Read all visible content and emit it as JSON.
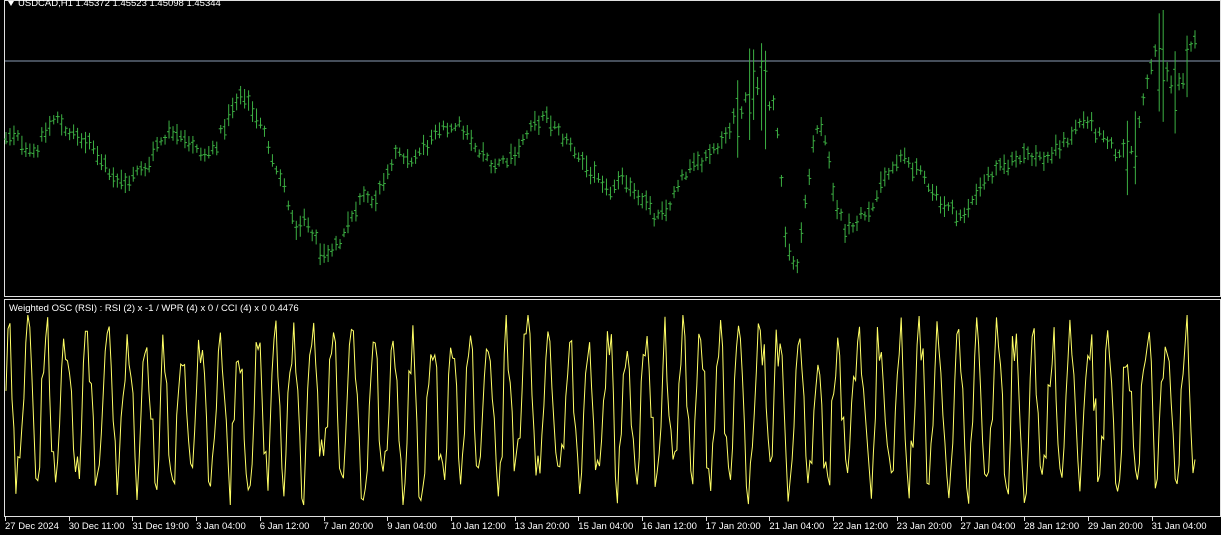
{
  "price_pane": {
    "symbol_label": "USDCAD,H1  1.45372 1.45523 1.45098 1.45344",
    "bar_color": "#3cb043"
  },
  "osc_pane": {
    "indicator_label": "Weighted OSC (RSI) : RSI (2) x -1 / WPR (4) x 0 / CCI (4) x 0 0.4476",
    "line_color": "#ffff66"
  },
  "time_axis": {
    "labels": [
      "27 Dec 2024",
      "30 Dec 11:00",
      "31 Dec 19:00",
      "3 Jan 04:00",
      "6 Jan 12:00",
      "7 Jan 20:00",
      "9 Jan 04:00",
      "10 Jan 12:00",
      "13 Jan 20:00",
      "15 Jan 04:00",
      "16 Jan 12:00",
      "17 Jan 20:00",
      "21 Jan 04:00",
      "22 Jan 12:00",
      "23 Jan 20:00",
      "27 Jan 04:00",
      "28 Jan 12:00",
      "29 Jan 20:00",
      "31 Jan 04:00"
    ]
  },
  "chart_data": [
    {
      "type": "bar",
      "title": "USDCAD,H1",
      "ohlc_last": {
        "open": 1.45372,
        "high": 1.45523,
        "low": 1.45098,
        "close": 1.45344
      },
      "close_profile": [
        0.54,
        0.55,
        0.52,
        0.5,
        0.57,
        0.62,
        0.58,
        0.55,
        0.53,
        0.5,
        0.45,
        0.4,
        0.38,
        0.42,
        0.44,
        0.52,
        0.56,
        0.58,
        0.55,
        0.5,
        0.48,
        0.52,
        0.6,
        0.67,
        0.7,
        0.63,
        0.55,
        0.45,
        0.35,
        0.2,
        0.25,
        0.18,
        0.1,
        0.15,
        0.22,
        0.3,
        0.35,
        0.32,
        0.42,
        0.5,
        0.45,
        0.48,
        0.52,
        0.55,
        0.58,
        0.6,
        0.57,
        0.5,
        0.48,
        0.45,
        0.47,
        0.5,
        0.55,
        0.6,
        0.62,
        0.58,
        0.54,
        0.5,
        0.45,
        0.4,
        0.35,
        0.37,
        0.4,
        0.36,
        0.32,
        0.25,
        0.28,
        0.35,
        0.42,
        0.45,
        0.48,
        0.52,
        0.55,
        0.62,
        0.68,
        0.74,
        0.7,
        0.65,
        0.2,
        0.05,
        0.3,
        0.6,
        0.55,
        0.3,
        0.22,
        0.25,
        0.28,
        0.33,
        0.4,
        0.45,
        0.48,
        0.43,
        0.4,
        0.35,
        0.3,
        0.28,
        0.26,
        0.35,
        0.4,
        0.42,
        0.45,
        0.47,
        0.5,
        0.48,
        0.47,
        0.5,
        0.53,
        0.58,
        0.62,
        0.57,
        0.53,
        0.5,
        0.49,
        0.5,
        0.72,
        0.85,
        0.8,
        0.7,
        0.78,
        0.92
      ]
    },
    {
      "type": "line",
      "title": "Weighted OSC (RSI) : RSI (2) x -1 / WPR (4) x 0 / CCI (4) x 0",
      "last_value": 0.4476,
      "profile_seed": 7
    }
  ]
}
